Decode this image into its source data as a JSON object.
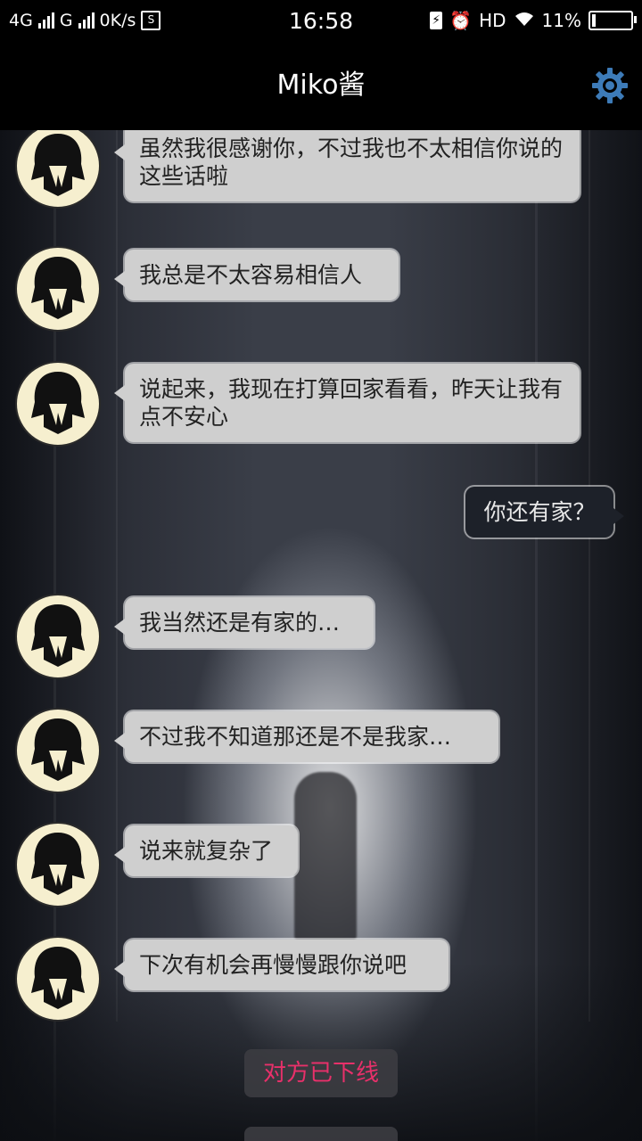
{
  "status_bar": {
    "network1": "4G",
    "network2": "G",
    "speed": "0K/s",
    "time": "16:58",
    "hd": "HD",
    "battery": "11%",
    "battery_level": 0.11
  },
  "header": {
    "title": "Miko酱",
    "settings_icon": "gear-icon"
  },
  "messages": [
    {
      "side": "left",
      "text": "虽然我很感谢你，不过我也不太相信你说的这些话啦"
    },
    {
      "side": "left",
      "text": "我总是不太容易相信人"
    },
    {
      "side": "left",
      "text": "说起来，我现在打算回家看看，昨天让我有点不安心"
    },
    {
      "side": "right",
      "text": "你还有家？"
    },
    {
      "side": "left",
      "text": "我当然还是有家的…"
    },
    {
      "side": "left",
      "text": "不过我不知道那还是不是我家…"
    },
    {
      "side": "left",
      "text": "说来就复杂了"
    },
    {
      "side": "left",
      "text": "下次有机会再慢慢跟你说吧"
    }
  ],
  "system_notice": "对方已下线",
  "system_notice_color": "#e8306a",
  "system_notice2_color": "#2fa86a"
}
